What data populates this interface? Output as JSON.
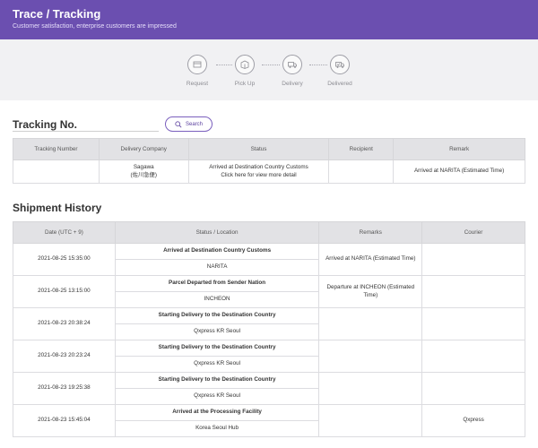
{
  "header": {
    "title": "Trace / Tracking",
    "subtitle": "Customer satisfaction, enterprise customers are impressed"
  },
  "steps": [
    {
      "label": "Request",
      "icon": "request-box-icon"
    },
    {
      "label": "Pick Up",
      "icon": "pickup-box-icon"
    },
    {
      "label": "Delivery",
      "icon": "delivery-truck-icon"
    },
    {
      "label": "Delivered",
      "icon": "delivered-truck-icon"
    }
  ],
  "tracking": {
    "title": "Tracking No.",
    "search_label": "Search",
    "headers": [
      "Tracking Number",
      "Delivery Company",
      "Status",
      "Recipient",
      "Remark"
    ],
    "row": {
      "tracking_number": "",
      "company_line1": "Sagawa",
      "company_line2": "(佐川急便)",
      "status_line1": "Arrived at Destination Country Customs",
      "status_link": "Click here for view more detail",
      "recipient": "",
      "remark": "Arrived at NARITA (Estimated Time)"
    }
  },
  "history": {
    "title": "Shipment History",
    "headers": [
      "Date (UTC + 9)",
      "Status / Location",
      "Remarks",
      "Courier"
    ],
    "rows": [
      {
        "date": "2021-08-25 15:35:00",
        "status": "Arrived at Destination Country Customs",
        "location": "NARITA",
        "remark": "Arrived at NARITA (Estimated Time)",
        "courier": ""
      },
      {
        "date": "2021-08-25 13:15:00",
        "status": "Parcel Departed from Sender Nation",
        "location": "INCHEON",
        "remark": "Departure at INCHEON (Estimated Time)",
        "courier": ""
      },
      {
        "date": "2021-08-23 20:38:24",
        "status": "Starting Delivery to the Destination Country",
        "location": "Qxpress KR Seoul",
        "remark": "",
        "courier": ""
      },
      {
        "date": "2021-08-23 20:23:24",
        "status": "Starting Delivery to the Destination Country",
        "location": "Qxpress KR Seoul",
        "remark": "",
        "courier": ""
      },
      {
        "date": "2021-08-23 19:25:38",
        "status": "Starting Delivery to the Destination Country",
        "location": "Qxpress KR Seoul",
        "remark": "",
        "courier": ""
      },
      {
        "date": "2021-08-23 15:45:04",
        "status": "Arrived at the Processing Facility",
        "location": "Korea Seoul Hub",
        "remark": "",
        "courier": "Qxpress"
      }
    ]
  },
  "colors": {
    "header_bg": "#6b4fb0",
    "accent": "#7a5fbd"
  }
}
